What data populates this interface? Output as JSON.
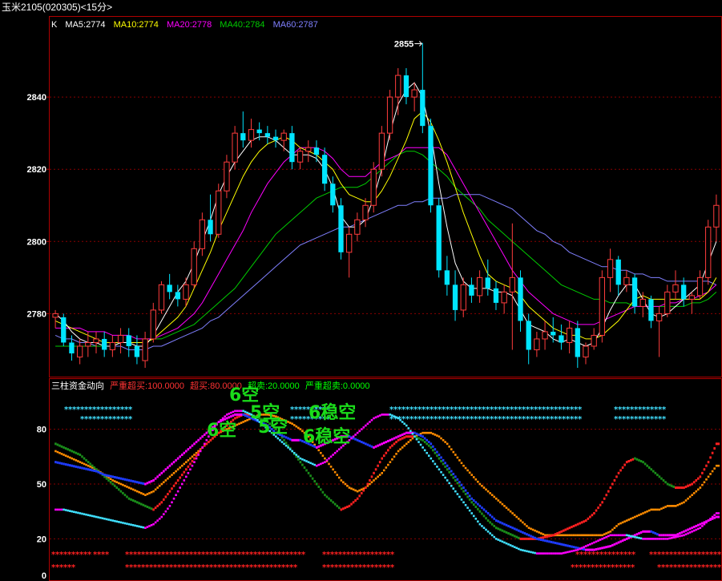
{
  "window": {
    "title": "玉米2105(020305)<15分>"
  },
  "main_panel": {
    "indicator_name": "K",
    "ma": [
      {
        "label": "MA5:2774",
        "color": "#ffffff"
      },
      {
        "label": "MA10:2774",
        "color": "#ffff00"
      },
      {
        "label": "MA20:2778",
        "color": "#ff00ff"
      },
      {
        "label": "MA40:2784",
        "color": "#00cc00"
      },
      {
        "label": "MA60:2787",
        "color": "#8080ff"
      }
    ],
    "high_marker": "2855",
    "y_ticks": [
      "2840",
      "2820",
      "2800",
      "2780"
    ]
  },
  "sub_panel": {
    "indicator_name": "三柱资金动向",
    "params": [
      {
        "label": "严重超买:100.0000",
        "color": "#ff3333"
      },
      {
        "label": "超买:80.0000",
        "color": "#ff3333"
      },
      {
        "label": "超卖:20.0000",
        "color": "#00ff00"
      },
      {
        "label": "严重超卖:0.0000",
        "color": "#00ff00"
      }
    ],
    "y_ticks": [
      "80",
      "50",
      "20",
      "0"
    ],
    "signals": [
      "6空",
      "5空",
      "6空",
      "5空",
      "6稳空",
      "6稳空"
    ]
  },
  "chart_data": {
    "type": "candlestick",
    "main_ylim": [
      2763,
      2858
    ],
    "sub_ylim": [
      0,
      100
    ],
    "candles_ohlc": [
      [
        2779,
        2781,
        2776,
        2780
      ],
      [
        2779,
        2780,
        2771,
        2772
      ],
      [
        2772,
        2774,
        2767,
        2769
      ],
      [
        2768,
        2773,
        2766,
        2771
      ],
      [
        2771,
        2775,
        2768,
        2772
      ],
      [
        2772,
        2775,
        2769,
        2773
      ],
      [
        2773,
        2775,
        2768,
        2770
      ],
      [
        2770,
        2774,
        2768,
        2772
      ],
      [
        2772,
        2776,
        2769,
        2774
      ],
      [
        2774,
        2776,
        2768,
        2771
      ],
      [
        2771,
        2774,
        2766,
        2768
      ],
      [
        2767,
        2775,
        2765,
        2773
      ],
      [
        2773,
        2783,
        2772,
        2781
      ],
      [
        2781,
        2789,
        2780,
        2788
      ],
      [
        2788,
        2791,
        2784,
        2786
      ],
      [
        2786,
        2788,
        2782,
        2784
      ],
      [
        2784,
        2790,
        2782,
        2788
      ],
      [
        2788,
        2800,
        2787,
        2798
      ],
      [
        2798,
        2808,
        2796,
        2806
      ],
      [
        2806,
        2813,
        2800,
        2802
      ],
      [
        2802,
        2816,
        2801,
        2814
      ],
      [
        2814,
        2824,
        2812,
        2822
      ],
      [
        2822,
        2832,
        2820,
        2830
      ],
      [
        2830,
        2836,
        2826,
        2828
      ],
      [
        2828,
        2834,
        2826,
        2831
      ],
      [
        2831,
        2833,
        2828,
        2830
      ],
      [
        2830,
        2832,
        2827,
        2829
      ],
      [
        2829,
        2831,
        2826,
        2828
      ],
      [
        2828,
        2831,
        2825,
        2830
      ],
      [
        2830,
        2832,
        2820,
        2822
      ],
      [
        2822,
        2826,
        2820,
        2825
      ],
      [
        2825,
        2828,
        2822,
        2826
      ],
      [
        2826,
        2828,
        2822,
        2824
      ],
      [
        2824,
        2826,
        2814,
        2816
      ],
      [
        2816,
        2818,
        2808,
        2810
      ],
      [
        2810,
        2812,
        2795,
        2797
      ],
      [
        2797,
        2804,
        2790,
        2802
      ],
      [
        2802,
        2808,
        2800,
        2806
      ],
      [
        2806,
        2812,
        2804,
        2810
      ],
      [
        2810,
        2822,
        2808,
        2820
      ],
      [
        2820,
        2832,
        2818,
        2830
      ],
      [
        2830,
        2842,
        2828,
        2840
      ],
      [
        2840,
        2848,
        2835,
        2846
      ],
      [
        2846,
        2848,
        2838,
        2840
      ],
      [
        2840,
        2844,
        2836,
        2842
      ],
      [
        2842,
        2855,
        2830,
        2832
      ],
      [
        2832,
        2834,
        2808,
        2810
      ],
      [
        2810,
        2812,
        2790,
        2792
      ],
      [
        2792,
        2796,
        2785,
        2788
      ],
      [
        2788,
        2792,
        2778,
        2781
      ],
      [
        2781,
        2790,
        2779,
        2788
      ],
      [
        2788,
        2790,
        2783,
        2785
      ],
      [
        2785,
        2792,
        2783,
        2790
      ],
      [
        2790,
        2795,
        2785,
        2787
      ],
      [
        2787,
        2789,
        2781,
        2783
      ],
      [
        2783,
        2788,
        2780,
        2786
      ],
      [
        2786,
        2805,
        2770,
        2790
      ],
      [
        2790,
        2792,
        2775,
        2778
      ],
      [
        2778,
        2780,
        2766,
        2770
      ],
      [
        2770,
        2775,
        2768,
        2773
      ],
      [
        2773,
        2778,
        2770,
        2775
      ],
      [
        2775,
        2779,
        2772,
        2774
      ],
      [
        2774,
        2777,
        2770,
        2772
      ],
      [
        2772,
        2778,
        2769,
        2776
      ],
      [
        2776,
        2778,
        2765,
        2768
      ],
      [
        2768,
        2772,
        2766,
        2771
      ],
      [
        2771,
        2776,
        2770,
        2774
      ],
      [
        2774,
        2792,
        2772,
        2790
      ],
      [
        2790,
        2798,
        2786,
        2795
      ],
      [
        2795,
        2796,
        2785,
        2788
      ],
      [
        2788,
        2792,
        2786,
        2790
      ],
      [
        2790,
        2791,
        2780,
        2782
      ],
      [
        2782,
        2786,
        2779,
        2784
      ],
      [
        2784,
        2785,
        2776,
        2778
      ],
      [
        2778,
        2782,
        2768,
        2780
      ],
      [
        2780,
        2788,
        2779,
        2786
      ],
      [
        2786,
        2792,
        2784,
        2788
      ],
      [
        2788,
        2790,
        2782,
        2784
      ],
      [
        2784,
        2786,
        2780,
        2785
      ],
      [
        2785,
        2792,
        2784,
        2790
      ],
      [
        2790,
        2806,
        2788,
        2804
      ],
      [
        2804,
        2813,
        2800,
        2810
      ]
    ],
    "ma5": [
      2780,
      2778,
      2775,
      2773,
      2772,
      2772,
      2771,
      2771,
      2772,
      2772,
      2771,
      2771,
      2774,
      2778,
      2782,
      2786,
      2789,
      2794,
      2800,
      2806,
      2813,
      2818,
      2822,
      2825,
      2828,
      2829,
      2829,
      2828,
      2826,
      2824,
      2824,
      2824,
      2823,
      2820,
      2815,
      2807,
      2804,
      2804,
      2806,
      2812,
      2820,
      2830,
      2838,
      2842,
      2844,
      2840,
      2830,
      2816,
      2804,
      2794,
      2789,
      2787,
      2787,
      2787,
      2786,
      2786,
      2785,
      2781,
      2777,
      2776,
      2775,
      2773,
      2772,
      2773,
      2772,
      2771,
      2772,
      2776,
      2781,
      2785,
      2788,
      2788,
      2784,
      2780,
      2779,
      2780,
      2782,
      2784,
      2786,
      2788,
      2794,
      2800
    ],
    "ma10": [
      2778,
      2777,
      2776,
      2775,
      2774,
      2773,
      2772,
      2772,
      2772,
      2772,
      2772,
      2772,
      2773,
      2775,
      2777,
      2779,
      2782,
      2787,
      2792,
      2797,
      2803,
      2808,
      2813,
      2818,
      2822,
      2825,
      2827,
      2828,
      2829,
      2828,
      2826,
      2825,
      2824,
      2822,
      2820,
      2816,
      2813,
      2812,
      2811,
      2811,
      2814,
      2818,
      2823,
      2828,
      2834,
      2836,
      2833,
      2828,
      2822,
      2815,
      2808,
      2802,
      2796,
      2791,
      2789,
      2788,
      2787,
      2785,
      2782,
      2780,
      2778,
      2776,
      2775,
      2774,
      2774,
      2773,
      2773,
      2774,
      2776,
      2778,
      2781,
      2784,
      2785,
      2784,
      2784,
      2784,
      2784,
      2784,
      2784,
      2784,
      2786,
      2790
    ],
    "ma20": [
      2776,
      2776,
      2776,
      2776,
      2775,
      2775,
      2775,
      2774,
      2774,
      2774,
      2773,
      2773,
      2773,
      2774,
      2775,
      2776,
      2778,
      2780,
      2783,
      2787,
      2791,
      2795,
      2799,
      2803,
      2808,
      2812,
      2816,
      2819,
      2822,
      2824,
      2826,
      2826,
      2826,
      2825,
      2823,
      2820,
      2818,
      2818,
      2818,
      2820,
      2822,
      2823,
      2824,
      2826,
      2826,
      2826,
      2826,
      2826,
      2824,
      2820,
      2816,
      2812,
      2808,
      2804,
      2800,
      2796,
      2792,
      2789,
      2786,
      2784,
      2782,
      2780,
      2779,
      2778,
      2777,
      2777,
      2777,
      2778,
      2779,
      2780,
      2781,
      2782,
      2782,
      2782,
      2782,
      2783,
      2783,
      2784,
      2784,
      2785,
      2786,
      2788
    ],
    "ma40": [
      2771,
      2771,
      2771,
      2771,
      2771,
      2771,
      2771,
      2771,
      2772,
      2772,
      2772,
      2772,
      2773,
      2773,
      2774,
      2775,
      2776,
      2777,
      2779,
      2781,
      2783,
      2785,
      2787,
      2790,
      2793,
      2796,
      2799,
      2802,
      2804,
      2806,
      2808,
      2810,
      2812,
      2813,
      2814,
      2815,
      2815,
      2815,
      2816,
      2818,
      2820,
      2822,
      2824,
      2825,
      2825,
      2824,
      2822,
      2820,
      2818,
      2815,
      2813,
      2811,
      2809,
      2806,
      2804,
      2802,
      2800,
      2798,
      2796,
      2794,
      2792,
      2790,
      2788,
      2787,
      2786,
      2785,
      2784,
      2784,
      2783,
      2783,
      2783,
      2782,
      2782,
      2782,
      2782,
      2782,
      2782,
      2782,
      2783,
      2783,
      2784,
      2786
    ],
    "ma60": [
      2774,
      2773,
      2773,
      2772,
      2772,
      2771,
      2771,
      2771,
      2771,
      2770,
      2770,
      2770,
      2771,
      2771,
      2772,
      2773,
      2774,
      2775,
      2776,
      2778,
      2779,
      2781,
      2783,
      2785,
      2787,
      2789,
      2791,
      2793,
      2795,
      2797,
      2799,
      2800,
      2801,
      2802,
      2803,
      2804,
      2804,
      2805,
      2806,
      2807,
      2808,
      2809,
      2810,
      2810,
      2811,
      2811,
      2812,
      2812,
      2812,
      2813,
      2813,
      2813,
      2813,
      2812,
      2811,
      2810,
      2809,
      2807,
      2805,
      2803,
      2802,
      2800,
      2799,
      2797,
      2796,
      2795,
      2794,
      2793,
      2793,
      2792,
      2792,
      2791,
      2791,
      2790,
      2790,
      2789,
      2789,
      2789,
      2789,
      2789,
      2789,
      2788
    ],
    "sub_series": [
      {
        "name": "orange",
        "values": [
          68,
          66,
          64,
          62,
          60,
          58,
          55,
          52,
          50,
          48,
          46,
          44,
          46,
          50,
          54,
          58,
          62,
          66,
          70,
          74,
          78,
          80,
          82,
          84,
          86,
          88,
          88,
          87,
          85,
          83,
          80,
          76,
          70,
          64,
          58,
          52,
          48,
          46,
          48,
          52,
          56,
          62,
          68,
          72,
          76,
          78,
          78,
          76,
          72,
          66,
          60,
          55,
          50,
          46,
          42,
          38,
          34,
          30,
          26,
          24,
          22,
          22,
          22,
          22,
          22,
          22,
          22,
          22,
          24,
          28,
          30,
          32,
          34,
          36,
          36,
          38,
          38,
          40,
          44,
          48,
          54,
          60
        ]
      },
      {
        "name": "red-green",
        "values": [
          72,
          70,
          68,
          66,
          62,
          58,
          54,
          50,
          46,
          42,
          40,
          38,
          36,
          40,
          46,
          52,
          58,
          64,
          70,
          74,
          78,
          82,
          86,
          88,
          88,
          86,
          84,
          80,
          74,
          68,
          62,
          56,
          50,
          44,
          40,
          36,
          38,
          42,
          48,
          56,
          64,
          70,
          74,
          76,
          76,
          74,
          70,
          64,
          58,
          52,
          46,
          40,
          35,
          30,
          26,
          24,
          22,
          20,
          20,
          20,
          21,
          22,
          24,
          26,
          28,
          30,
          34,
          40,
          48,
          56,
          62,
          64,
          62,
          58,
          54,
          50,
          48,
          48,
          50,
          54,
          62,
          72
        ]
      },
      {
        "name": "blue-cyan",
        "values": [
          62,
          61,
          60,
          59,
          58,
          57,
          55,
          54,
          53,
          52,
          51,
          50,
          52,
          56,
          60,
          64,
          68,
          72,
          76,
          80,
          84,
          86,
          88,
          88,
          86,
          84,
          82,
          78,
          76,
          74,
          74,
          72,
          70,
          72,
          74,
          76,
          76,
          74,
          72,
          70,
          72,
          74,
          76,
          78,
          78,
          76,
          72,
          66,
          60,
          54,
          48,
          42,
          38,
          34,
          30,
          28,
          26,
          24,
          22,
          20,
          19,
          18,
          17,
          16,
          15,
          14,
          14,
          15,
          16,
          18,
          20,
          22,
          24,
          24,
          22,
          22,
          22,
          24,
          26,
          28,
          30,
          32
        ]
      },
      {
        "name": "cyan-low",
        "values": [
          36,
          36,
          35,
          34,
          33,
          32,
          31,
          30,
          29,
          28,
          27,
          26,
          28,
          32,
          38,
          46,
          54,
          62,
          70,
          78,
          84,
          88,
          90,
          90,
          88,
          84,
          80,
          76,
          72,
          68,
          64,
          62,
          60,
          62,
          66,
          70,
          74,
          78,
          82,
          86,
          88,
          88,
          86,
          82,
          76,
          70,
          64,
          58,
          52,
          46,
          40,
          34,
          28,
          24,
          20,
          18,
          16,
          14,
          13,
          12,
          12,
          12,
          12,
          13,
          14,
          16,
          18,
          20,
          22,
          22,
          22,
          21,
          20,
          20,
          20,
          20,
          21,
          22,
          24,
          26,
          30,
          34
        ]
      }
    ]
  }
}
